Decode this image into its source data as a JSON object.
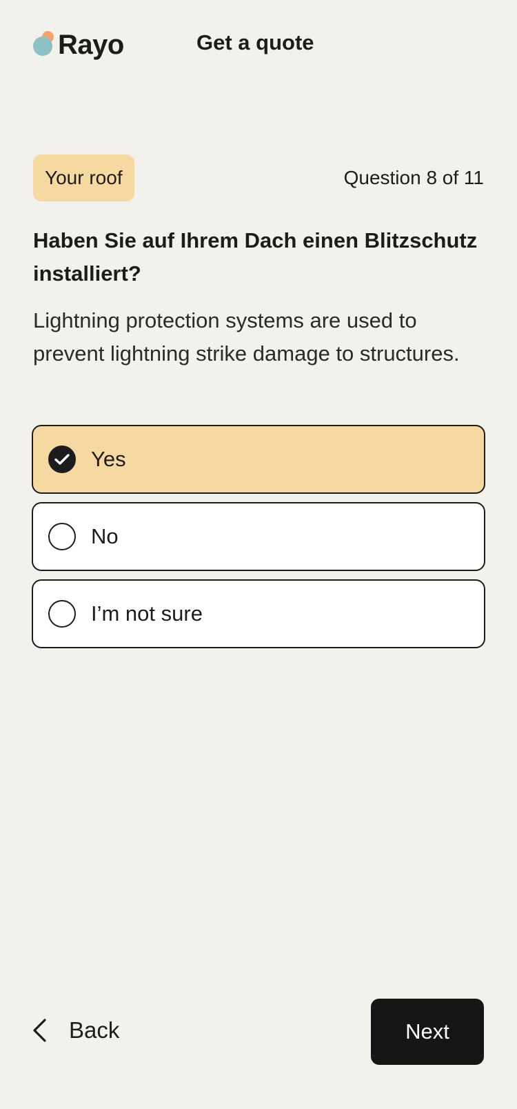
{
  "header": {
    "logo_text": "Rayo",
    "title": "Get a quote"
  },
  "section_badge": "Your roof",
  "progress": {
    "text": "Question 8 of 11",
    "current": 8,
    "total": 11
  },
  "question": "Haben Sie auf Ihrem Dach einen Blitzschutz installiert?",
  "description": "Lightning protection systems are used to prevent lightning strike damage to structures.",
  "options": [
    {
      "label": "Yes",
      "selected": true
    },
    {
      "label": "No",
      "selected": false
    },
    {
      "label": "I’m not sure",
      "selected": false
    }
  ],
  "footer": {
    "back_label": "Back",
    "next_label": "Next"
  },
  "icons": {
    "logo": "rayo-logo-icon",
    "check": "check-circle-icon",
    "radio": "radio-empty-icon",
    "back": "chevron-left-icon"
  },
  "colors": {
    "background": "#f3f1eb",
    "accent": "#f6d9a1",
    "logo_orange": "#f4a36a",
    "logo_teal": "#8dc2c4",
    "primary_button": "#161616"
  }
}
